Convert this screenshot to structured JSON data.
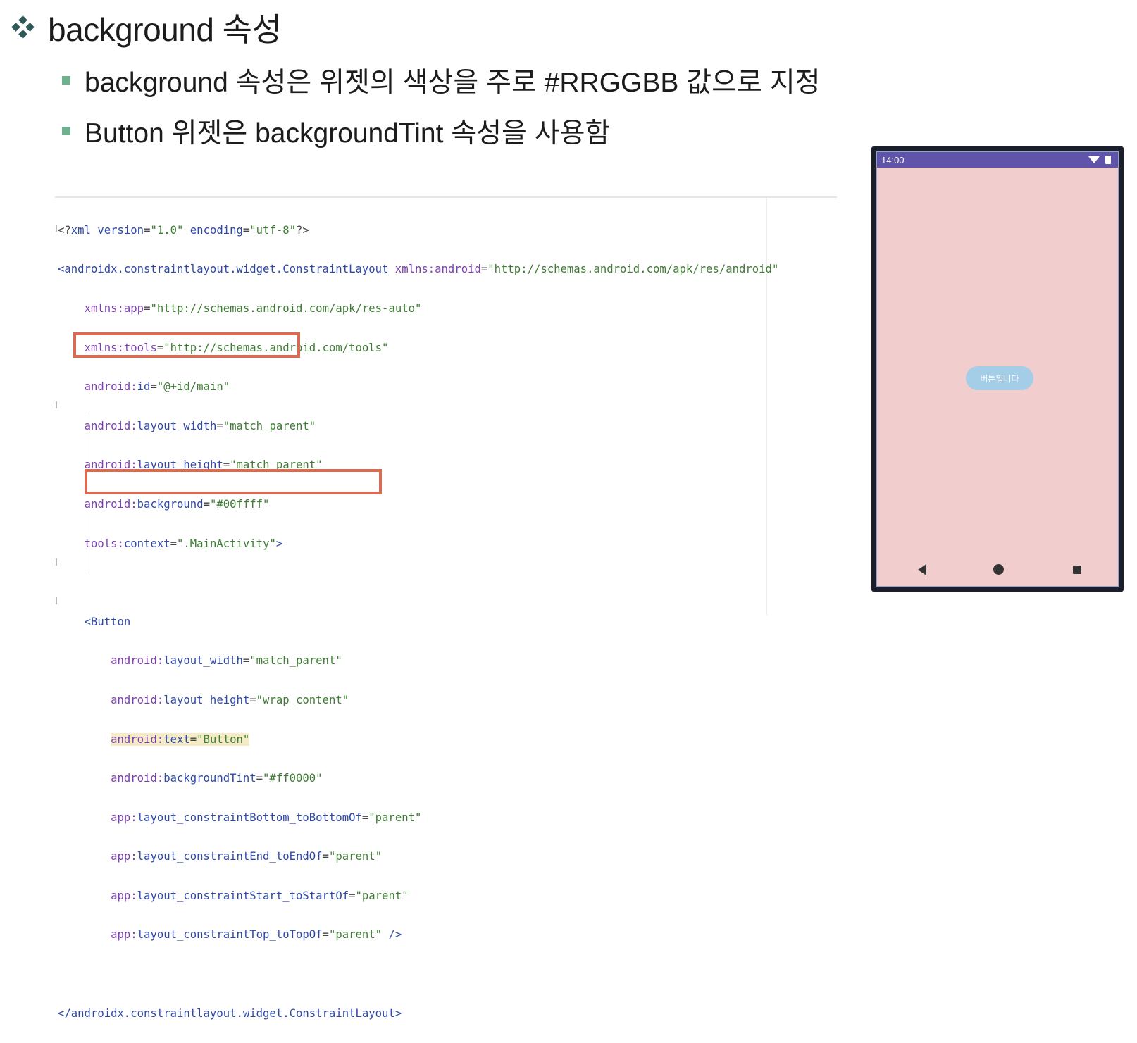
{
  "title": "background 속성",
  "bullets": [
    "background 속성은 위젯의 색상을 주로 #RRGGBB 값으로 지정",
    "Button 위젯은 backgroundTint 속성을 사용함"
  ],
  "code": {
    "l1_a": "<?",
    "l1_b": "xml version",
    "l1_c": "=",
    "l1_d": "\"1.0\"",
    "l1_e": " encoding",
    "l1_f": "=",
    "l1_g": "\"utf-8\"",
    "l1_h": "?>",
    "l2_tag": "<androidx.constraintlayout.widget.ConstraintLayout",
    "l2_ns": " xmlns:",
    "l2_attr": "android",
    "l2_eq": "=",
    "l2_val": "\"http://schemas.android.com/apk/res/android\"",
    "l3_ns": "xmlns:",
    "l3_attr": "app",
    "l3_val": "\"http://schemas.android.com/apk/res-auto\"",
    "l4_ns": "xmlns:",
    "l4_attr": "tools",
    "l4_val": "\"http://schemas.android.com/tools\"",
    "l5_ns": "android:",
    "l5_attr": "id",
    "l5_val": "\"@+id/main\"",
    "l6_ns": "android:",
    "l6_attr": "layout_width",
    "l6_val": "\"match_parent\"",
    "l7_ns": "android:",
    "l7_attr": "layout_height",
    "l7_val": "\"match_parent\"",
    "l8_ns": "android:",
    "l8_attr": "background",
    "l8_val": "\"#00ffff\"",
    "l9_ns": "tools:",
    "l9_attr": "context",
    "l9_val": "\".MainActivity\"",
    "l9_end": ">",
    "l11_tag": "<Button",
    "l12_ns": "android:",
    "l12_attr": "layout_width",
    "l12_val": "\"match_parent\"",
    "l13_ns": "android:",
    "l13_attr": "layout_height",
    "l13_val": "\"wrap_content\"",
    "l14_ns": "android:",
    "l14_attr": "text",
    "l14_val": "\"Button\"",
    "l15_ns": "android:",
    "l15_attr": "backgroundTint",
    "l15_val": "\"#ff0000\"",
    "l16_ns": "app:",
    "l16_attr": "layout_constraintBottom_toBottomOf",
    "l16_val": "\"parent\"",
    "l17_ns": "app:",
    "l17_attr": "layout_constraintEnd_toEndOf",
    "l17_val": "\"parent\"",
    "l18_ns": "app:",
    "l18_attr": "layout_constraintStart_toStartOf",
    "l18_val": "\"parent\"",
    "l19_ns": "app:",
    "l19_attr": "layout_constraintTop_toTopOf",
    "l19_val": "\"parent\"",
    "l19_end": " />",
    "l21_tag": "</androidx.constraintlayout.widget.ConstraintLayout>"
  },
  "phone": {
    "time": "14:00",
    "button_label": "버튼입니다"
  },
  "colors": {
    "status_bar": "#5e54a9",
    "screen_background": "#f1cdcd",
    "highlight_box": "#d86b54",
    "button": "#a4cde8"
  }
}
